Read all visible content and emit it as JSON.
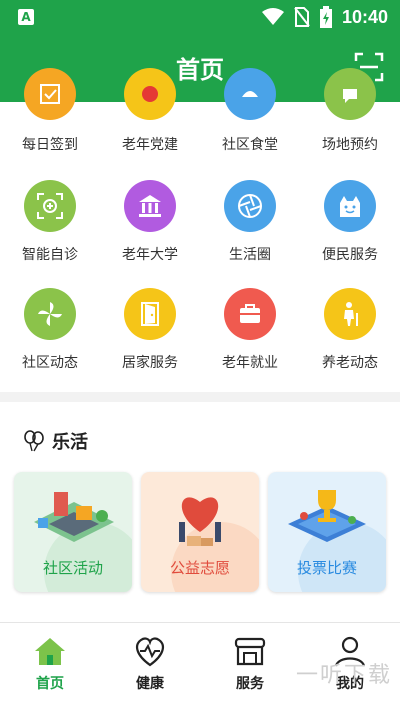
{
  "status_bar": {
    "time": "10:40",
    "notification_icon": "A"
  },
  "header": {
    "title": "首页",
    "scan_icon": "scan-icon"
  },
  "grid": {
    "rows": [
      [
        {
          "label": "每日签到",
          "icon": "checkin-icon",
          "color": "#f5a623"
        },
        {
          "label": "老年党建",
          "icon": "party-icon",
          "color": "#f5c518"
        },
        {
          "label": "社区食堂",
          "icon": "canteen-icon",
          "color": "#4aa3e8"
        },
        {
          "label": "场地预约",
          "icon": "booking-icon",
          "color": "#8bc34a"
        }
      ],
      [
        {
          "label": "智能自诊",
          "icon": "diagnosis-icon",
          "color": "#8bc34a"
        },
        {
          "label": "老年大学",
          "icon": "university-icon",
          "color": "#b15be0"
        },
        {
          "label": "生活圈",
          "icon": "lifecircle-icon",
          "color": "#4aa3e8"
        },
        {
          "label": "便民服务",
          "icon": "convenience-icon",
          "color": "#4aa3e8"
        }
      ],
      [
        {
          "label": "社区动态",
          "icon": "community-news-icon",
          "color": "#8bc34a"
        },
        {
          "label": "居家服务",
          "icon": "home-service-icon",
          "color": "#f5c518"
        },
        {
          "label": "老年就业",
          "icon": "employment-icon",
          "color": "#f05a4f"
        },
        {
          "label": "养老动态",
          "icon": "elderly-news-icon",
          "color": "#f5c518"
        }
      ]
    ]
  },
  "section": {
    "title": "乐活",
    "icon": "balloon-icon"
  },
  "cards": [
    {
      "label": "社区活动",
      "bg": "#e6f4ea",
      "accent": "#1fa34a",
      "text_color": "#1fa34a"
    },
    {
      "label": "公益志愿",
      "bg": "#fde9d9",
      "accent": "#e04b3c",
      "text_color": "#e04b3c"
    },
    {
      "label": "投票比赛",
      "bg": "#e3f1fb",
      "accent": "#2a8be0",
      "text_color": "#2a8be0"
    }
  ],
  "tabbar": {
    "items": [
      {
        "label": "首页",
        "icon": "home-icon",
        "active": true
      },
      {
        "label": "健康",
        "icon": "heart-pulse-icon",
        "active": false
      },
      {
        "label": "服务",
        "icon": "store-icon",
        "active": false
      },
      {
        "label": "我的",
        "icon": "user-icon",
        "active": false
      }
    ]
  },
  "watermark": "一听下载",
  "colors": {
    "primary": "#1fa34a",
    "active_tab": "#1fa34a"
  }
}
